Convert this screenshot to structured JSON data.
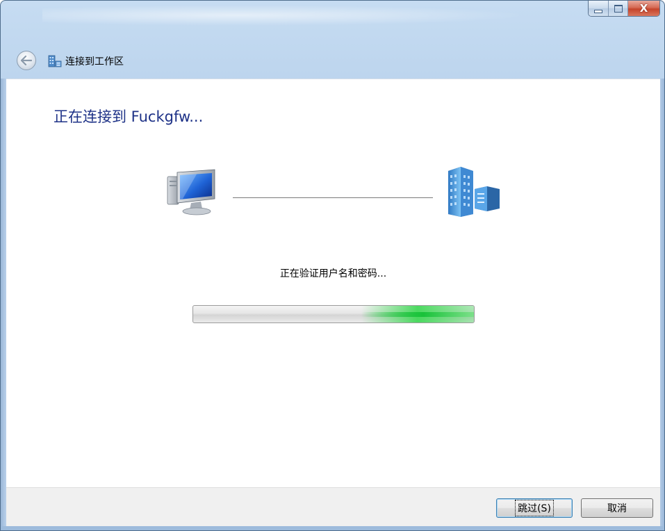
{
  "window": {
    "title": "连接到工作区",
    "caption_buttons": {
      "minimize_icon": "minimize-icon",
      "maximize_icon": "maximize-icon",
      "close_glyph": "X"
    }
  },
  "wizard": {
    "main_instruction": "正在连接到 Fuckgfw...",
    "status_text": "正在验证用户名和密码...",
    "progress": {
      "state": "indeterminate-marquee",
      "highlight_start_fraction": 0.6,
      "highlight_end_fraction": 1.0,
      "color": "#2fd647"
    }
  },
  "icons": {
    "back": "back-arrow-icon",
    "window_icon": "workplace-network-icon",
    "left": "computer-icon",
    "right": "workplace-server-icon"
  },
  "footer": {
    "skip_label": "跳过(S)",
    "cancel_label": "取消"
  }
}
